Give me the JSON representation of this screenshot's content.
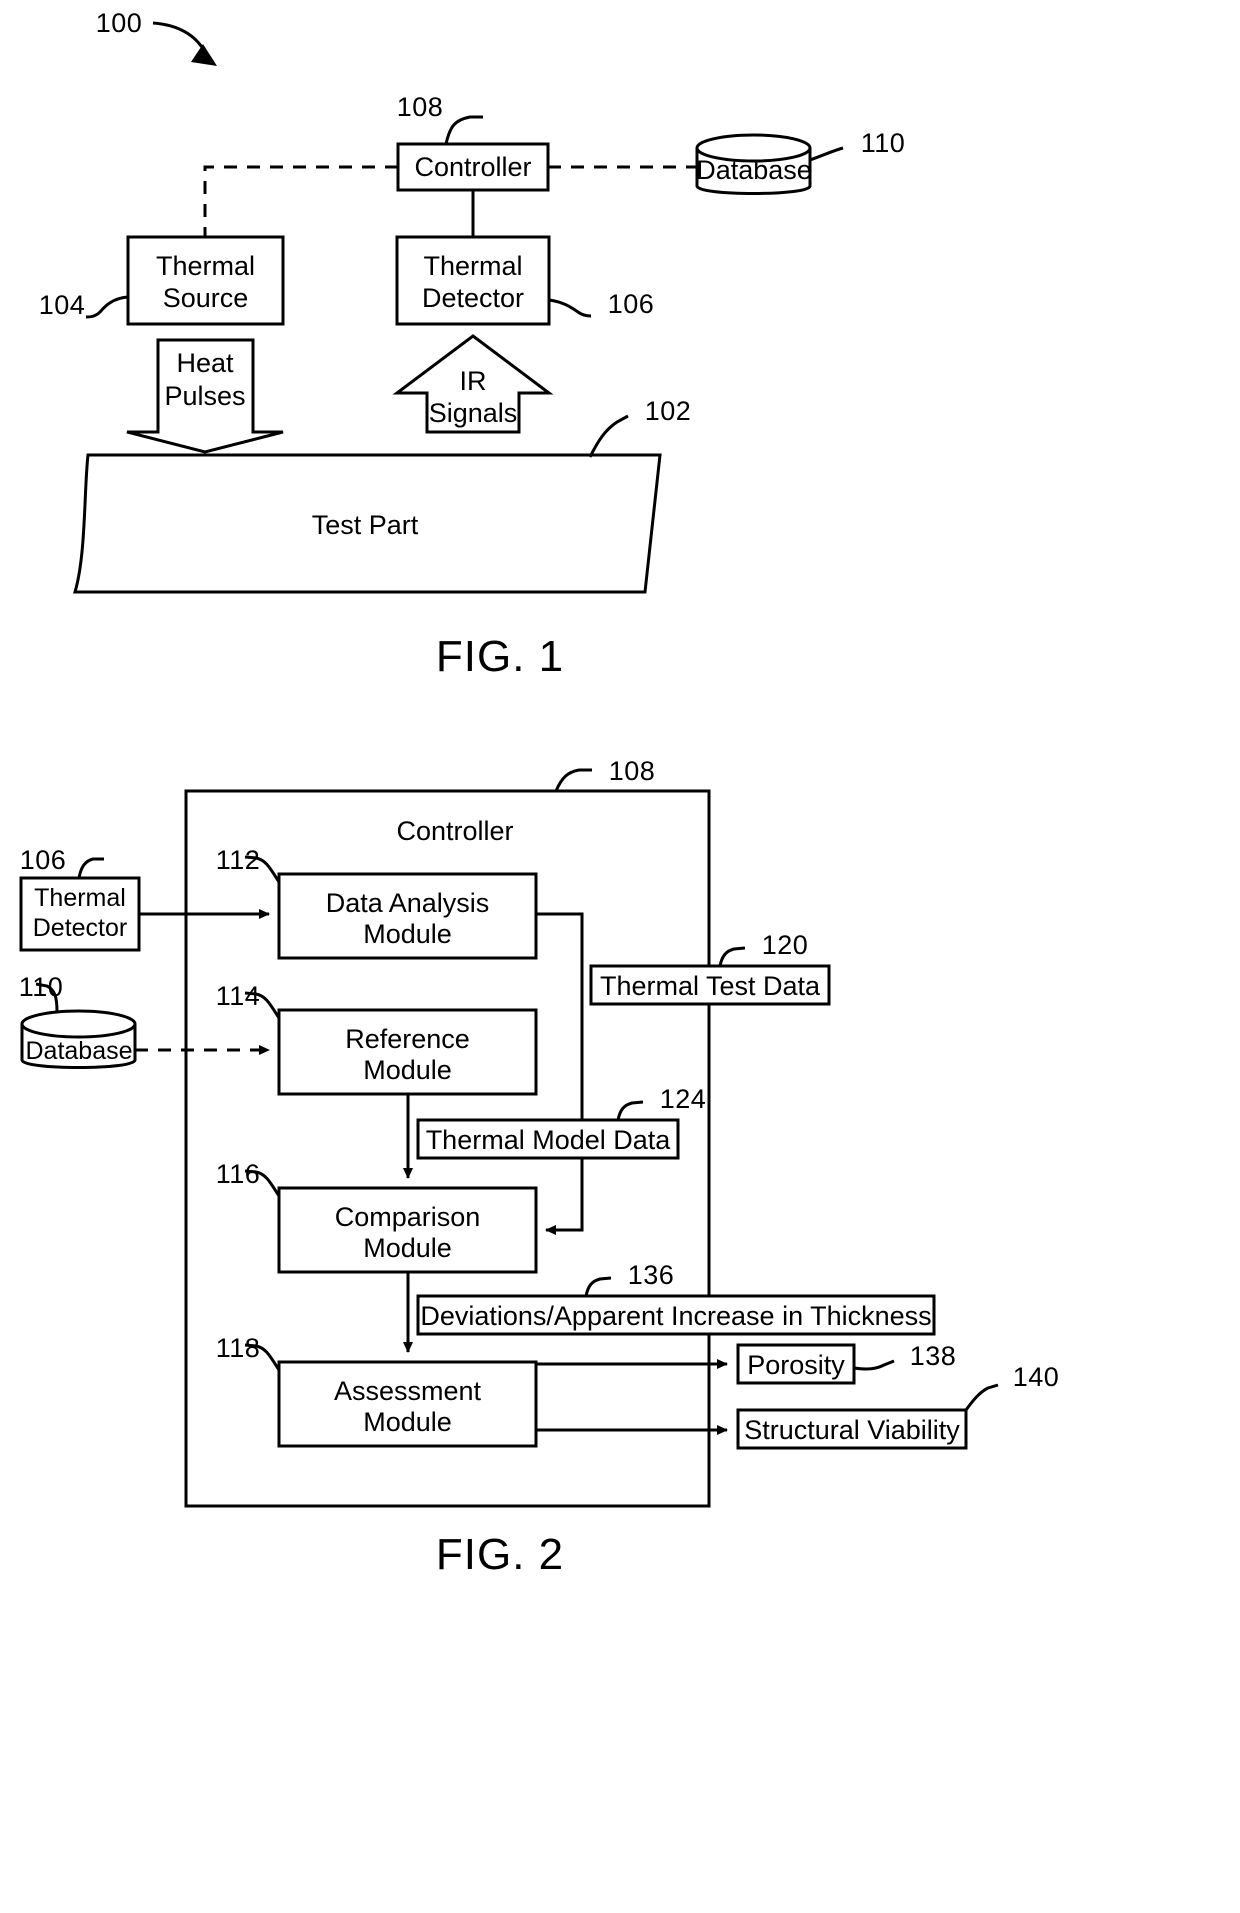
{
  "figures": [
    {
      "id": "fig1",
      "caption": "FIG. 1",
      "system_ref": "100",
      "nodes": {
        "controller": {
          "label": "Controller",
          "ref": "108"
        },
        "database": {
          "label": "Database",
          "ref": "110"
        },
        "thermal_source": {
          "label": "Thermal\nSource",
          "line1": "Thermal",
          "line2": "Source",
          "ref": "104"
        },
        "thermal_detector": {
          "label": "Thermal\nDetector",
          "line1": "Thermal",
          "line2": "Detector",
          "ref": "106"
        },
        "heat_pulses": {
          "line1": "Heat",
          "line2": "Pulses"
        },
        "ir_signals": {
          "line1": "IR",
          "line2": "Signals"
        },
        "test_part": {
          "label": "Test Part",
          "ref": "102"
        }
      }
    },
    {
      "id": "fig2",
      "caption": "FIG. 2",
      "nodes": {
        "controller": {
          "label": "Controller",
          "ref": "108"
        },
        "thermal_detector": {
          "line1": "Thermal",
          "line2": "Detector",
          "ref": "106"
        },
        "database": {
          "label": "Database",
          "ref": "110"
        },
        "data_analysis_module": {
          "line1": "Data Analysis",
          "line2": "Module",
          "ref": "112"
        },
        "reference_module": {
          "line1": "Reference",
          "line2": "Module",
          "ref": "114"
        },
        "comparison_module": {
          "line1": "Comparison",
          "line2": "Module",
          "ref": "116"
        },
        "assessment_module": {
          "line1": "Assessment",
          "line2": "Module",
          "ref": "118"
        },
        "thermal_test_data": {
          "label": "Thermal Test Data",
          "ref": "120"
        },
        "thermal_model_data": {
          "label": "Thermal Model Data",
          "ref": "124"
        },
        "deviations": {
          "label": "Deviations/Apparent Increase in Thickness",
          "ref": "136"
        },
        "porosity": {
          "label": "Porosity",
          "ref": "138"
        },
        "structural_viability": {
          "label": "Structural Viability",
          "ref": "140"
        }
      }
    }
  ]
}
